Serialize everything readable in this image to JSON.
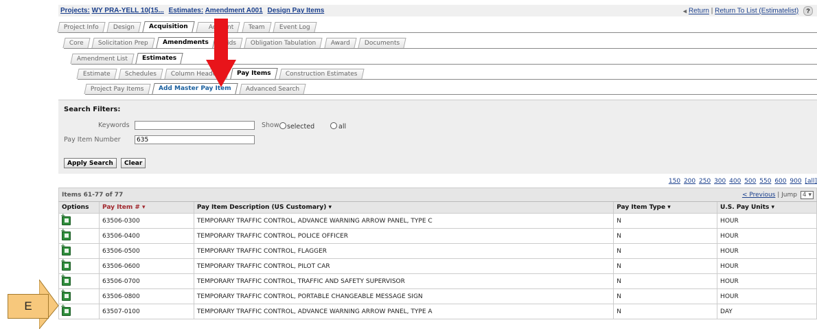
{
  "breadcrumb": {
    "projects_label": "Projects:",
    "project_name": "WY PRA-YELL 10(15...",
    "estimates_label": "Estimates:",
    "amendment": "Amendment A001",
    "page": "Design Pay Items"
  },
  "top_right": {
    "return": "Return",
    "separator": "|",
    "return_to_list": "Return To List (Estimatelist)",
    "help": "?"
  },
  "tabs_row1": [
    "Project Info",
    "Design",
    "Acquisition",
    "Account",
    "Team",
    "Event Log"
  ],
  "tabs_row2": [
    "Core",
    "Solicitation Prep",
    "Amendments",
    "Bids",
    "Obligation Tabulation",
    "Award",
    "Documents"
  ],
  "tabs_row3": [
    "Amendment List",
    "Estimates"
  ],
  "tabs_row4": [
    "Estimate",
    "Schedules",
    "Column Headers",
    "Pay Items",
    "Construction Estimates"
  ],
  "tabs_row5": [
    "Project Pay Items",
    "Add Master Pay Item",
    "Advanced Search"
  ],
  "search": {
    "title": "Search Filters:",
    "keywords_label": "Keywords",
    "keywords_value": "",
    "show_label": "Show",
    "opt_selected": "selected",
    "opt_all": "all",
    "pay_item_label": "Pay Item Number",
    "pay_item_value": "635",
    "apply_button": "Apply Search",
    "clear_button": "Clear"
  },
  "pagination": {
    "sizes": [
      "150",
      "200",
      "250",
      "300",
      "400",
      "500",
      "550",
      "600",
      "900",
      "[all]"
    ],
    "items_count": "Items 61-77 of 77",
    "previous": "< Previous",
    "jump_label": "| Jump",
    "jump_value": "4"
  },
  "table": {
    "headers": [
      "Options",
      "Pay Item # ▾",
      "Pay Item Description (US Customary) ▾",
      "Pay Item Type ▾",
      "U.S. Pay Units ▾"
    ],
    "rows": [
      {
        "num": "63506-0300",
        "desc": "TEMPORARY TRAFFIC CONTROL, ADVANCE WARNING ARROW PANEL, TYPE C",
        "type": "N",
        "unit": "HOUR"
      },
      {
        "num": "63506-0400",
        "desc": "TEMPORARY TRAFFIC CONTROL, POLICE OFFICER",
        "type": "N",
        "unit": "HOUR"
      },
      {
        "num": "63506-0500",
        "desc": "TEMPORARY TRAFFIC CONTROL, FLAGGER",
        "type": "N",
        "unit": "HOUR"
      },
      {
        "num": "63506-0600",
        "desc": "TEMPORARY TRAFFIC CONTROL, PILOT CAR",
        "type": "N",
        "unit": "HOUR"
      },
      {
        "num": "63506-0700",
        "desc": "TEMPORARY TRAFFIC CONTROL, TRAFFIC AND SAFETY SUPERVISOR",
        "type": "N",
        "unit": "HOUR"
      },
      {
        "num": "63506-0800",
        "desc": "TEMPORARY TRAFFIC CONTROL, PORTABLE CHANGEABLE MESSAGE SIGN",
        "type": "N",
        "unit": "HOUR"
      },
      {
        "num": "63507-0100",
        "desc": "TEMPORARY TRAFFIC CONTROL, ADVANCE WARNING ARROW PANEL, TYPE A",
        "type": "N",
        "unit": "DAY"
      }
    ]
  },
  "annotation": {
    "step_label": "E",
    "arrow_color": "#e8141a",
    "callout_color": "#f7c87c"
  }
}
